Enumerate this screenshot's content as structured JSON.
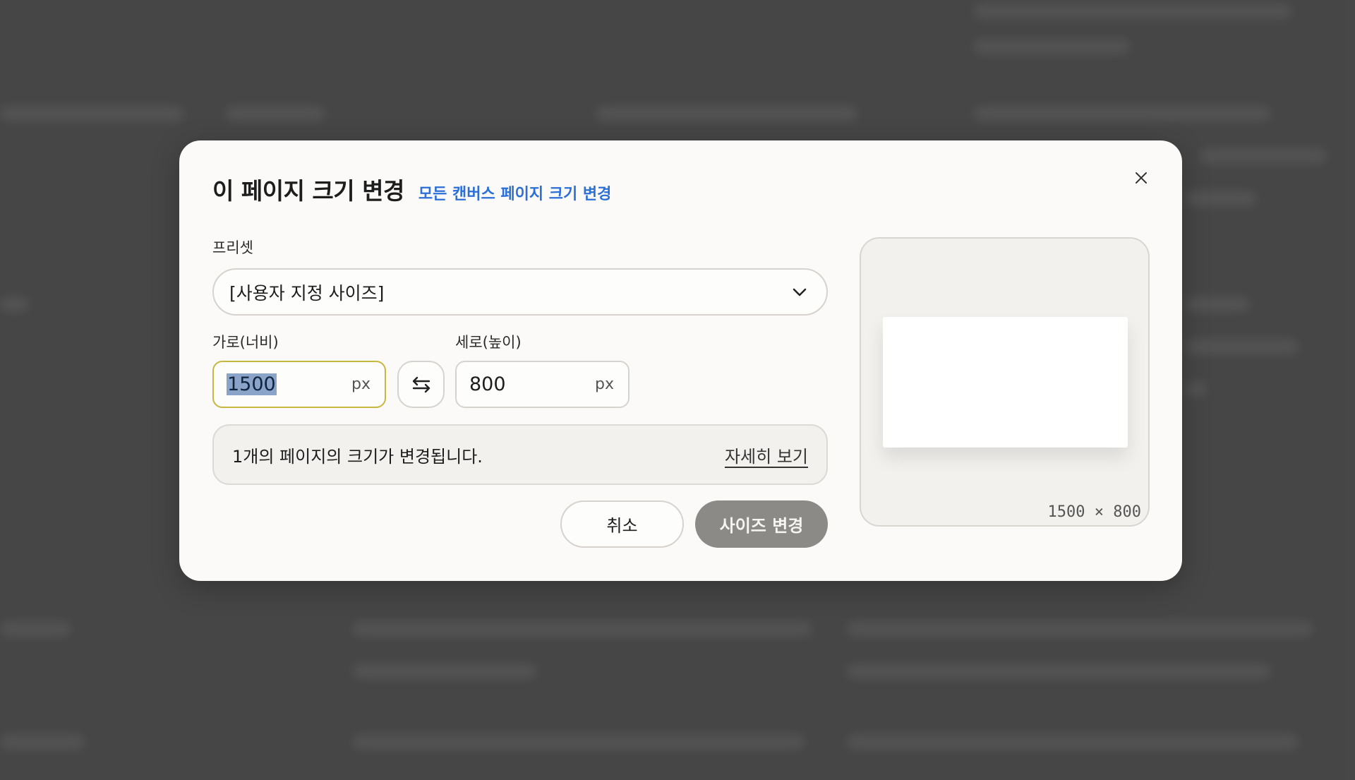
{
  "dialog": {
    "title": "이 페이지 크기 변경",
    "all_pages_link": "모든 캔버스 페이지 크기 변경",
    "close_icon": "close-icon"
  },
  "preset": {
    "label": "프리셋",
    "selected": "[사용자 지정 사이즈]",
    "chevron_icon": "chevron-down-icon"
  },
  "width": {
    "label": "가로(너비)",
    "value": "1500",
    "unit": "px"
  },
  "height": {
    "label": "세로(높이)",
    "value": "800",
    "unit": "px"
  },
  "swap": {
    "icon": "swap-arrows-icon"
  },
  "info": {
    "message": "1개의 페이지의 크기가 변경됩니다.",
    "details_link": "자세히 보기"
  },
  "actions": {
    "cancel_label": "취소",
    "confirm_label": "사이즈 변경"
  },
  "preview": {
    "dimensions": "1500 × 800"
  },
  "colors": {
    "accent_link": "#2c6fd6",
    "active_input_border": "#c6b83e",
    "primary_button": "#8c8a86"
  }
}
